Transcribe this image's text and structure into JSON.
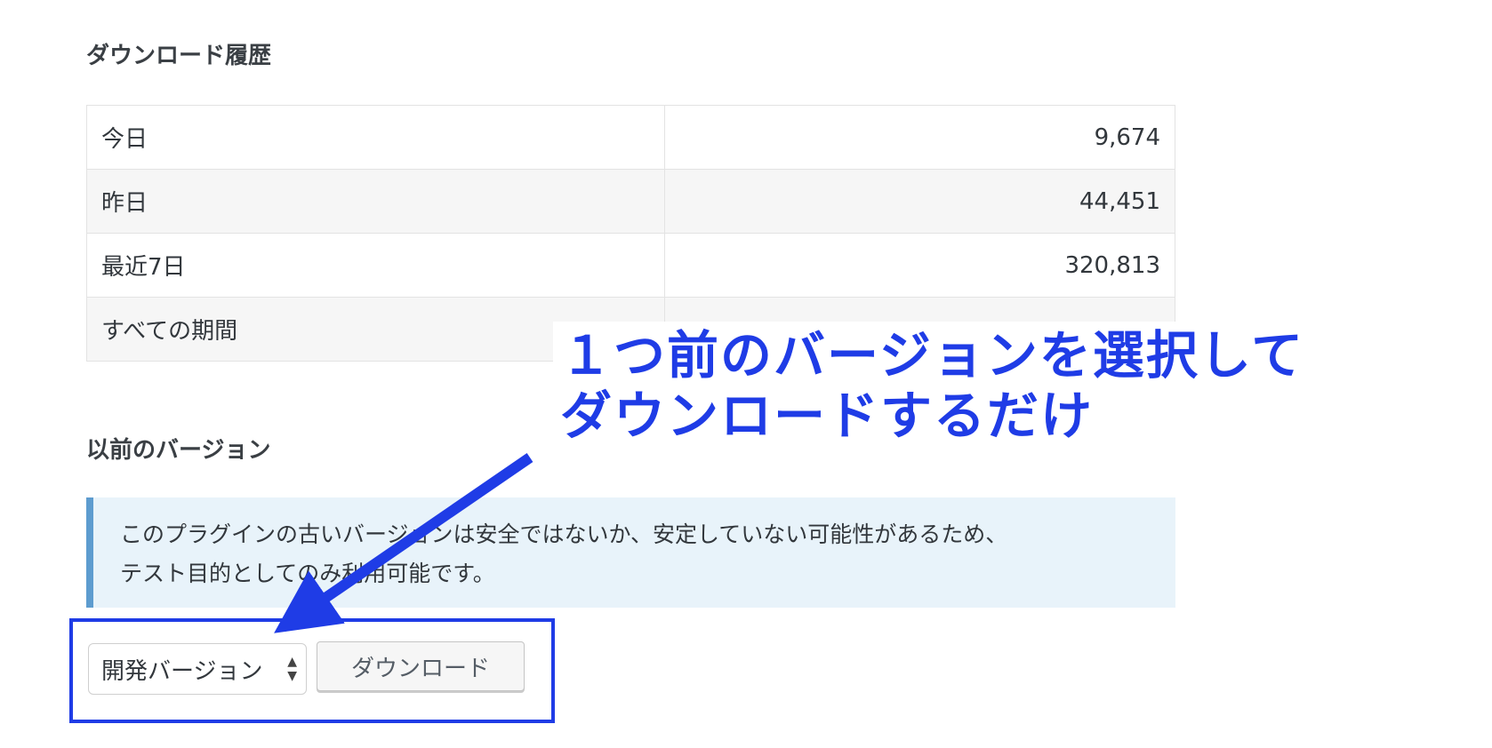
{
  "history": {
    "title": "ダウンロード履歴",
    "rows": [
      {
        "label": "今日",
        "value": "9,674"
      },
      {
        "label": "昨日",
        "value": "44,451"
      },
      {
        "label": "最近7日",
        "value": "320,813"
      },
      {
        "label": "すべての期間",
        "value": ""
      }
    ]
  },
  "previous_versions": {
    "title": "以前のバージョン",
    "notice_line1": "このプラグインの古いバージョンは安全ではないか、安定していない可能性があるため、",
    "notice_line2": "テスト目的としてのみ利用可能です。",
    "select_value": "開発バージョン",
    "download_button": "ダウンロード"
  },
  "annotation": {
    "line1": "１つ前のバージョンを選択して",
    "line2": "ダウンロードするだけ",
    "color": "#1f3ce6"
  }
}
